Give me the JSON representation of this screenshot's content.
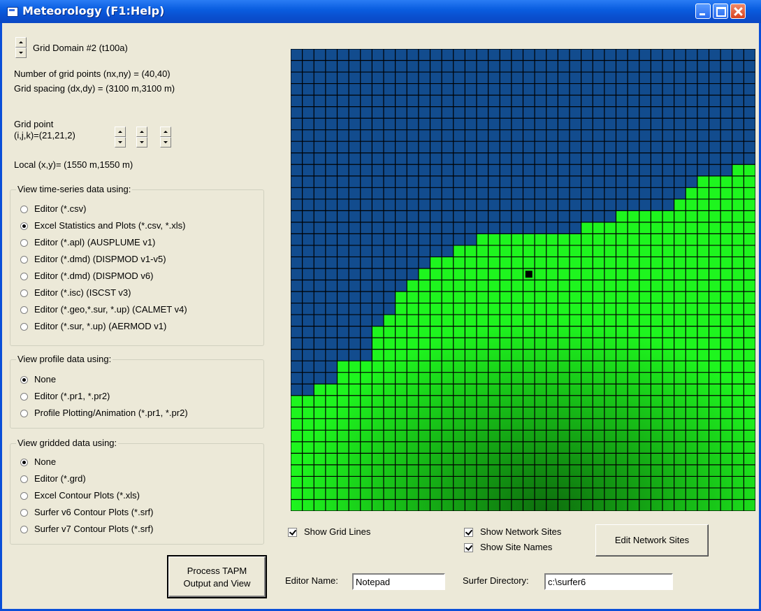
{
  "window": {
    "title": "Meteorology (F1:Help)"
  },
  "domain": {
    "label": "Grid Domain #2 (t100a)"
  },
  "info": {
    "grid_points": "Number of grid points (nx,ny) = (40,40)",
    "grid_spacing": "Grid spacing (dx,dy) = (3100 m,3100 m)",
    "grid_point_line1": "Grid point",
    "grid_point_line2": "(i,j,k)=(21,21,2)",
    "local": "Local (x,y)= (1550 m,1550 m)"
  },
  "timeseries": {
    "caption": "View time-series data using:",
    "options": [
      "Editor (*.csv)",
      "Excel Statistics and Plots (*.csv, *.xls)",
      "Editor (*.apl) (AUSPLUME v1)",
      "Editor (*.dmd) (DISPMOD v1-v5)",
      "Editor (*.dmd) (DISPMOD v6)",
      "Editor (*.isc) (ISCST v3)",
      "Editor (*.geo,*.sur, *.up) (CALMET v4)",
      "Editor (*.sur, *.up) (AERMOD v1)"
    ],
    "selected": 1
  },
  "profile": {
    "caption": "View profile data using:",
    "options": [
      "None",
      "Editor (*.pr1, *.pr2)",
      "Profile Plotting/Animation (*.pr1, *.pr2)"
    ],
    "selected": 0
  },
  "gridded": {
    "caption": "View gridded data using:",
    "options": [
      "None",
      "Editor (*.grd)",
      "Excel Contour Plots (*.xls)",
      "Surfer v6 Contour Plots (*.srf)",
      "Surfer v7 Contour Plots (*.srf)"
    ],
    "selected": 0
  },
  "process_button": {
    "line1": "Process TAPM",
    "line2": "Output and View"
  },
  "options": {
    "show_grid_lines": "Show Grid Lines",
    "show_network_sites": "Show Network Sites",
    "show_site_names": "Show Site Names",
    "edit_network_sites": "Edit Network Sites"
  },
  "editor": {
    "label": "Editor Name:",
    "value": "Notepad"
  },
  "surfer": {
    "label": "Surfer Directory:",
    "value": "c:\\surfer6"
  },
  "map": {
    "grid_cells": 40,
    "colors": {
      "sea": "#124c8e",
      "land": "#1ef51e",
      "grid": "#000000",
      "site": "#000000"
    },
    "coast_profile": [
      10,
      10,
      11,
      11,
      13,
      13,
      13,
      16,
      17,
      19,
      20,
      21,
      22,
      22,
      23,
      23,
      24,
      24,
      24,
      24,
      24,
      24,
      24,
      24,
      24,
      25,
      25,
      25,
      26,
      26,
      26,
      26,
      26,
      27,
      28,
      29,
      29,
      29,
      30,
      30
    ],
    "site_cell": [
      20,
      19
    ]
  }
}
